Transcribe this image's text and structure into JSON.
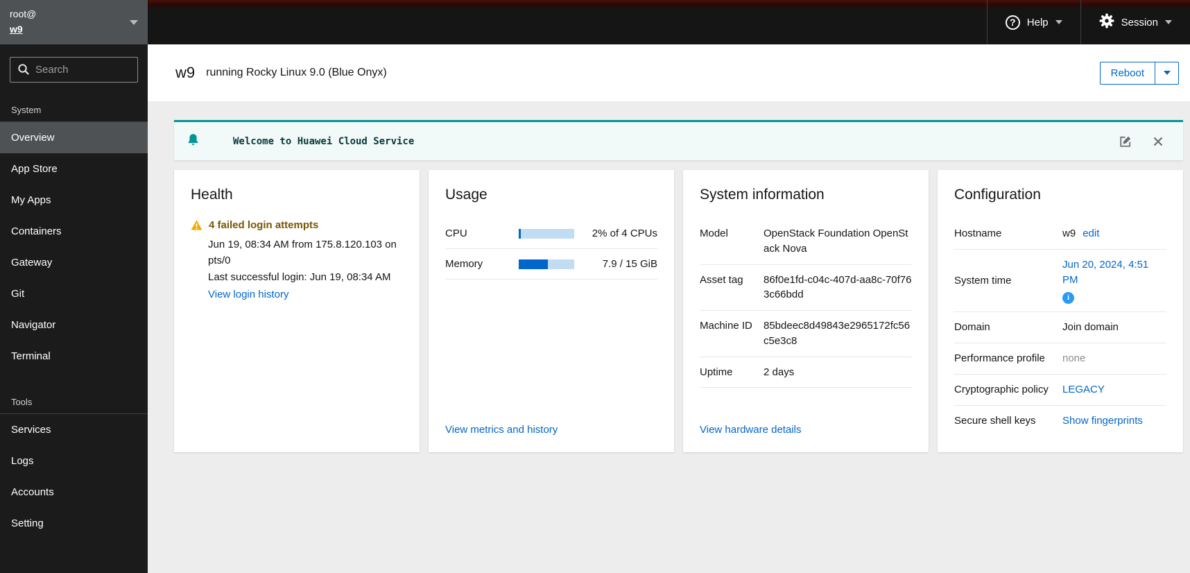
{
  "brand": {
    "user": "root@",
    "host": "w9"
  },
  "masthead": {
    "help_label": "Help",
    "session_label": "Session"
  },
  "sidebar": {
    "search_placeholder": "Search",
    "sections": [
      {
        "label": "System",
        "items": [
          {
            "label": "Overview",
            "selected": true
          },
          {
            "label": "App Store"
          },
          {
            "label": "My Apps"
          },
          {
            "label": "Containers"
          },
          {
            "label": "Gateway"
          },
          {
            "label": "Git"
          },
          {
            "label": "Navigator"
          },
          {
            "label": "Terminal"
          }
        ]
      },
      {
        "label": "Tools",
        "items": [
          {
            "label": "Services"
          },
          {
            "label": "Logs"
          },
          {
            "label": "Accounts"
          },
          {
            "label": "Setting"
          }
        ]
      }
    ]
  },
  "header": {
    "hostname": "w9",
    "os": "running Rocky Linux 9.0 (Blue Onyx)",
    "reboot_label": "Reboot"
  },
  "banner": {
    "title": "Welcome to Huawei Cloud Service"
  },
  "cards": {
    "health": {
      "title": "Health",
      "alert_title": "4 failed login attempts",
      "line1": "Jun 19, 08:34 AM from 175.8.120.103 on pts/0",
      "line2": "Last successful login: Jun 19, 08:34 AM",
      "link": "View login history"
    },
    "usage": {
      "title": "Usage",
      "rows": [
        {
          "label": "CPU",
          "value": "2% of 4 CPUs",
          "percent": 4
        },
        {
          "label": "Memory",
          "value": "7.9 / 15 GiB",
          "percent": 52.7
        }
      ],
      "link": "View metrics and history"
    },
    "system_info": {
      "title": "System information",
      "rows": [
        {
          "label": "Model",
          "value": "OpenStack Foundation OpenStack Nova"
        },
        {
          "label": "Asset tag",
          "value": "86f0e1fd-c04c-407d-aa8c-70f763c66bdd"
        },
        {
          "label": "Machine ID",
          "value": "85bdeec8d49843e2965172fc56c5e3c8"
        },
        {
          "label": "Uptime",
          "value": "2 days"
        }
      ],
      "link": "View hardware details"
    },
    "configuration": {
      "title": "Configuration",
      "hostname_label": "Hostname",
      "hostname_value": "w9",
      "hostname_edit": "edit",
      "system_time_label": "System time",
      "system_time_value": "Jun 20, 2024, 4:51 PM",
      "domain_label": "Domain",
      "domain_value": "Join domain",
      "perf_label": "Performance profile",
      "perf_value": "none",
      "crypto_label": "Cryptographic policy",
      "crypto_value": "LEGACY",
      "ssh_label": "Secure shell keys",
      "ssh_value": "Show fingerprints"
    }
  },
  "icons": {
    "help_glyph": "?",
    "info_glyph": "i"
  },
  "colors": {
    "accent_blue": "#0066cc",
    "banner_teal": "#009596",
    "warning_gold": "#f0ab00",
    "info_blue": "#2b9af3",
    "masthead_bg": "#151515",
    "sidebar_bg": "#1b1b1b",
    "brand_bg": "#4f5255"
  }
}
